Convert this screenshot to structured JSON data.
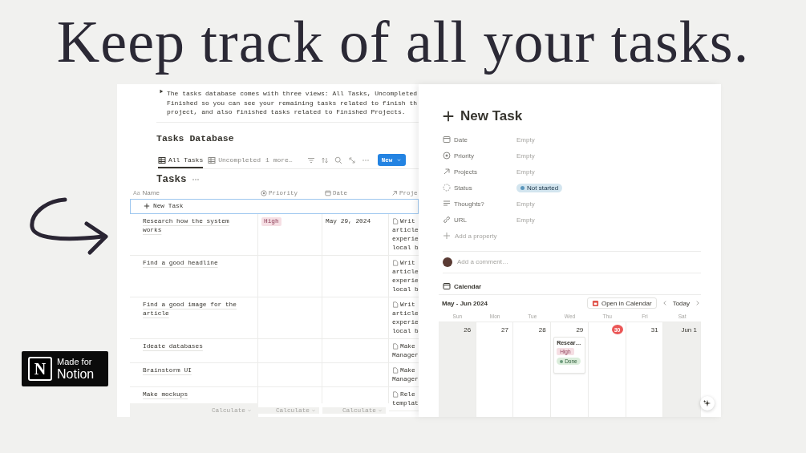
{
  "headline": "Keep track of all your tasks.",
  "page": {
    "toggle_lines": [
      "The tasks database comes with three views: All Tasks, Uncompleted",
      "Finished so you can see your remaining tasks related to finish th",
      "project, and also finished tasks related to Finished Projects."
    ],
    "section_title": "Tasks Database",
    "views": [
      {
        "label": "All Tasks",
        "selected": true
      },
      {
        "label": "Uncompleted",
        "selected": false
      }
    ],
    "more_views": "1 more…",
    "new_button": "New",
    "database_title": "Tasks",
    "columns": [
      {
        "label": "Name",
        "kind": "title",
        "type_icon": "Aa"
      },
      {
        "label": "Priority",
        "kind": "select"
      },
      {
        "label": "Date",
        "kind": "date"
      },
      {
        "label": "Proje",
        "kind": "relation"
      }
    ],
    "new_row": "New Task",
    "rows": [
      {
        "name": "Research how the system works",
        "priority": "High",
        "date": "May 29, 2024",
        "project": [
          "Writ",
          "article",
          "experie",
          "local b"
        ]
      },
      {
        "name": "Find a good headline",
        "project": [
          "Writ",
          "article",
          "experie",
          "local b"
        ]
      },
      {
        "name": "Find a good image for the article",
        "project": [
          "Writ",
          "article",
          "experie",
          "local b"
        ]
      },
      {
        "name": "Ideate databases",
        "project": [
          "Make",
          "Manager"
        ]
      },
      {
        "name": "Brainstorm UI",
        "project": [
          "Make",
          "Manager"
        ]
      },
      {
        "name": "Make mockups",
        "project": [
          "Rele",
          "templat"
        ]
      }
    ],
    "calculate": [
      "Calculate",
      "Calculate",
      "Calculate"
    ]
  },
  "task_panel": {
    "title": "New Task",
    "properties": [
      {
        "kind": "date",
        "label": "Date",
        "value": "Empty"
      },
      {
        "kind": "select",
        "label": "Priority",
        "value": "Empty"
      },
      {
        "kind": "relation",
        "label": "Projects",
        "value": "Empty"
      },
      {
        "kind": "status",
        "label": "Status",
        "value": "Not started"
      },
      {
        "kind": "text",
        "label": "Thoughts?",
        "value": "Empty"
      },
      {
        "kind": "url",
        "label": "URL",
        "value": "Empty"
      }
    ],
    "add_property": "Add a property",
    "comment_placeholder": "Add a comment…",
    "calendar": {
      "title": "Calendar",
      "range": "May - Jun 2024",
      "open_button": "Open in Calendar",
      "today_button": "Today",
      "weekdays": [
        "Sun",
        "Mon",
        "Tue",
        "Wed",
        "Thu",
        "Fri",
        "Sat"
      ],
      "days": [
        {
          "label": "26",
          "weekend": true,
          "today": false
        },
        {
          "label": "27",
          "weekend": false,
          "today": false
        },
        {
          "label": "28",
          "weekend": false,
          "today": false
        },
        {
          "label": "29",
          "weekend": false,
          "today": false,
          "event": {
            "title": "Resear…",
            "tags": [
              {
                "kind": "priority",
                "label": "High"
              },
              {
                "kind": "status",
                "label": "Done"
              }
            ]
          }
        },
        {
          "label": "30",
          "weekend": false,
          "today": true
        },
        {
          "label": "31",
          "weekend": false,
          "today": false
        },
        {
          "label": "Jun 1",
          "weekend": true,
          "today": false
        }
      ]
    }
  },
  "badge": {
    "logo_letter": "N",
    "line1": "Made for",
    "line2": "Notion"
  }
}
